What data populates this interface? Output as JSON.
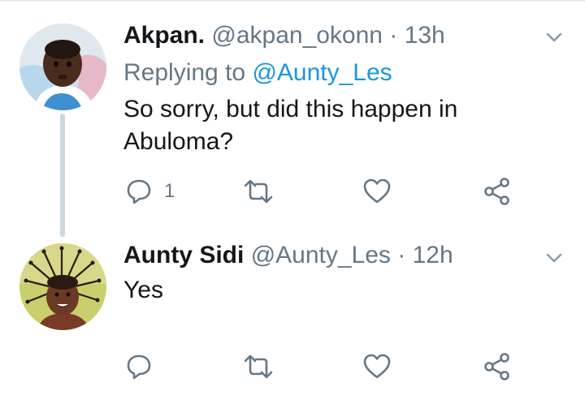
{
  "tweets": [
    {
      "name": "Akpan.",
      "handle": "@akpan_okonn",
      "separator": "·",
      "time": "13h",
      "replying_prefix": "Replying to ",
      "replying_to": "@Aunty_Les",
      "text_lines": [
        "So sorry, but did this happen in",
        "Abuloma?"
      ],
      "reply_count": "1",
      "avatar_icon": "baby-photo-avatar"
    },
    {
      "name": "Aunty Sidi",
      "handle": "@Aunty_Les",
      "separator": "·",
      "time": "12h",
      "text_lines": [
        "Yes"
      ],
      "reply_count": "",
      "avatar_icon": "girl-braids-photo-avatar"
    }
  ],
  "colors": {
    "text": "#14171a",
    "secondary": "#657786",
    "link": "#1b95e0",
    "divider": "#e6ecf0",
    "thread_line": "#ccd6dd"
  },
  "icons": [
    "reply-icon",
    "retweet-icon",
    "like-icon",
    "share-icon",
    "chevron-down-icon"
  ]
}
